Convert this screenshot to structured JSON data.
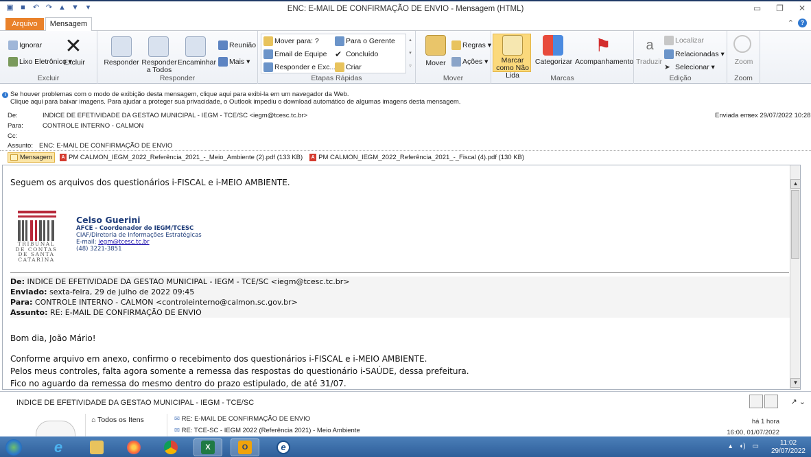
{
  "window": {
    "title": "ENC: E-MAIL DE CONFIRMAÇÃO DE ENVIO  -  Mensagem (HTML)"
  },
  "tabs": {
    "file": "Arquivo",
    "message": "Mensagem"
  },
  "ribbon": {
    "excluir": {
      "ignore": "Ignorar",
      "junk": "Lixo Eletrônico",
      "delete": "Excluir",
      "label": "Excluir"
    },
    "responder": {
      "reply": "Responder",
      "reply_all": "Responder a Todos",
      "forward": "Encaminhar",
      "meeting": "Reunião",
      "more": "Mais",
      "label": "Responder"
    },
    "quick": {
      "move_to": "Mover para: ?",
      "team_email": "Email de Equipe",
      "reply_delete": "Responder e Exc...",
      "to_manager": "Para o Gerente",
      "done": "Concluído",
      "create": "Criar",
      "label": "Etapas Rápidas"
    },
    "mover": {
      "move": "Mover",
      "rules": "Regras",
      "actions": "Ações",
      "label": "Mover"
    },
    "marcas": {
      "mark_unread": "Marcar como Não Lida",
      "categorize": "Categorizar",
      "followup": "Acompanhamento",
      "label": "Marcas"
    },
    "edicao": {
      "translate": "Traduzir",
      "find": "Localizar",
      "related": "Relacionadas",
      "select": "Selecionar",
      "label": "Edição"
    },
    "zoom": {
      "zoom": "Zoom",
      "label": "Zoom"
    }
  },
  "infobar": {
    "line1": "Se houver problemas com o modo de exibição desta mensagem, clique aqui para exibi-la em um navegador da Web.",
    "line2": "Clique aqui para baixar imagens. Para ajudar a proteger sua privacidade, o Outlook impediu o download automático de algumas imagens desta mensagem."
  },
  "header": {
    "from_label": "De:",
    "from": "INDICE DE EFETIVIDADE DA GESTAO MUNICIPAL - IEGM - TCE/SC <iegm@tcesc.tc.br>",
    "sent_label": "Enviada em:",
    "sent": "sex 29/07/2022 10:28",
    "to_label": "Para:",
    "to": "CONTROLE INTERNO - CALMON",
    "cc_label": "Cc:",
    "subject_label": "Assunto:",
    "subject": "ENC: E-MAIL DE CONFIRMAÇÃO DE ENVIO"
  },
  "attachments": {
    "message": "Mensagem",
    "items": [
      "PM CALMON_IEGM_2022_Referência_2021_-_Meio_Ambiente (2).pdf (133 KB)",
      "PM CALMON_IEGM_2022_Referência_2021_-_Fiscal (4).pdf (130 KB)"
    ]
  },
  "body": {
    "intro": "Seguem os arquivos dos questionários i-FISCAL e i-MEIO AMBIENTE.",
    "logo_text": "TRIBUNAL DE CONTAS DE SANTA CATARINA",
    "signature": {
      "name": "Celso Guerini",
      "role": "AFCE - Coordenador do IEGM/TCESC",
      "dept": "CIAF/Diretoria de Informações Estratégicas",
      "email_label": "E-mail: ",
      "email": "iegm@tcesc.tc.br",
      "phone": "(48) 3221-3851"
    },
    "forwarded": {
      "from_label": "De:",
      "from": " INDICE DE EFETIVIDADE DA GESTAO MUNICIPAL - IEGM - TCE/SC <iegm@tcesc.tc.br>",
      "sent_label": "Enviado:",
      "sent": " sexta-feira, 29 de julho de 2022 09:45",
      "to_label": "Para:",
      "to": " CONTROLE INTERNO - CALMON <controleinterno@calmon.sc.gov.br>",
      "subject_label": "Assunto:",
      "subject": " RE: E-MAIL DE CONFIRMAÇÃO DE ENVIO"
    },
    "greeting": "Bom dia, João Mário!",
    "p1": "Conforme arquivo em anexo, confirmo o recebimento dos questionários i-FISCAL e i-MEIO AMBIENTE.",
    "p2": "Pelos meus controles, falta agora somente a remessa das respostas do questionário i-SAÚDE, dessa prefeitura.",
    "p3": "Fico no aguardo da remessa do mesmo dentro do prazo estipulado, de até 31/07."
  },
  "people_pane": {
    "title": "INDICE DE EFETIVIDADE DA GESTAO MUNICIPAL - IEGM - TCE/SC",
    "nav_item": "Todos os Itens",
    "rows": [
      {
        "subject": "RE: E-MAIL DE CONFIRMAÇÃO DE ENVIO",
        "time": "há 1 hora"
      },
      {
        "subject": "RE: TCE-SC - IEGM 2022 (Referência 2021) - Meio Ambiente",
        "time": "16:00, 01/07/2022"
      }
    ]
  },
  "taskbar": {
    "time": "11:02",
    "date": "29/07/2022"
  },
  "colors": {
    "file_tab": "#e9812a",
    "signature_blue": "#1f3d7a",
    "taskbar": "#3a6aa6"
  }
}
